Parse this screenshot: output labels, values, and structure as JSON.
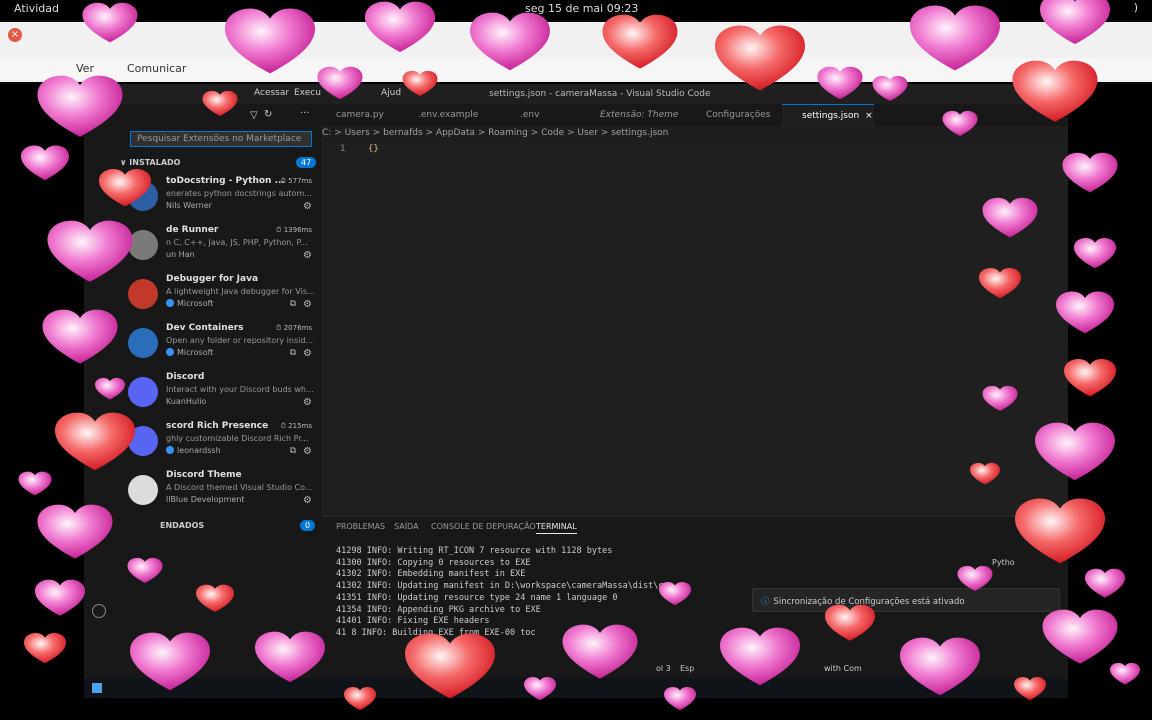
{
  "os": {
    "activities": "Atividad",
    "clock": "seg 15 de mai  09:23",
    "power": ")"
  },
  "browser": {
    "menu": [
      "Ver",
      "Comunicar"
    ]
  },
  "vscode": {
    "menu": [
      "Acessar",
      "Execu",
      "Ajud"
    ],
    "window_title": "settings.json - cameraMassa - Visual Studio Code",
    "search_placeholder": "Pesquisar Extensões no Marketplace",
    "installed": {
      "label": "INSTALADO",
      "count": "47"
    },
    "recommended": {
      "label": "ENDADOS",
      "count": "0"
    },
    "extensions": [
      {
        "name": "toDocstring - Python ...",
        "desc": "enerates python docstrings autom...",
        "publisher": "Nils Werner",
        "time": "577ms",
        "verified": false,
        "color": "#2d5fa6"
      },
      {
        "name": "de Runner",
        "desc": "n C, C++, Java, JS, PHP, Python, P...",
        "publisher": "un Han",
        "time": "1396ms",
        "verified": false,
        "color": "#7a7a7a"
      },
      {
        "name": "Debugger for Java",
        "desc": "A lightweight Java debugger for Vis...",
        "publisher": "Microsoft",
        "time": "",
        "verified": true,
        "color": "#c0392b"
      },
      {
        "name": "Dev Containers",
        "desc": "Open any folder or repository insid...",
        "publisher": "Microsoft",
        "time": "2076ms",
        "verified": true,
        "color": "#2a6ebb"
      },
      {
        "name": "Discord",
        "desc": "Interact with your Discord buds whil...",
        "publisher": "KuanHulio",
        "time": "",
        "verified": false,
        "color": "#5865f2"
      },
      {
        "name": "scord Rich Presence",
        "desc": "ghly customizable Discord Rich Pr...",
        "publisher": "leonardssh",
        "time": "215ms",
        "verified": true,
        "color": "#5865f2"
      },
      {
        "name": "Discord Theme",
        "desc": "A Discord themed Visual Studio Co...",
        "publisher": "llBlue Development",
        "time": "",
        "verified": false,
        "color": "#dcdcdc"
      }
    ],
    "tabs": [
      "camera.py",
      ".env.example",
      ".env",
      "Extensão: Theme",
      "Configurações",
      "settings.json"
    ],
    "breadcrumb": [
      "C:",
      "Users",
      "bernafds",
      "AppData",
      "Roaming",
      "Code",
      "User",
      "settings.json"
    ],
    "editor": {
      "line": "1",
      "code": "{}"
    },
    "panel_tabs": [
      "PROBLEMAS",
      "SAÍDA",
      "CONSOLE DE DEPURAÇÃO",
      "TERMINAL"
    ],
    "terminal": [
      "41298 INFO: Writing RT_ICON 7 resource with 1128 bytes",
      "41300 INFO: Copying 0 resources to EXE",
      "41302 INFO: Embedding manifest in EXE",
      "41302 INFO: Updating manifest in D:\\workspace\\cameraMassa\\dist\\ca",
      "41351 INFO: Updating resource type 24 name 1 language 0",
      "41354 INFO: Appending PKG archive to EXE",
      "41401 INFO: Fixing EXE headers",
      "41 8 INFO: Building EXE from EXE-00 toc"
    ],
    "notification": "Sincronização de Configurações está ativado",
    "status": [
      "ol 3",
      "Esp",
      "with Com"
    ],
    "side_panel": "Pytho"
  }
}
